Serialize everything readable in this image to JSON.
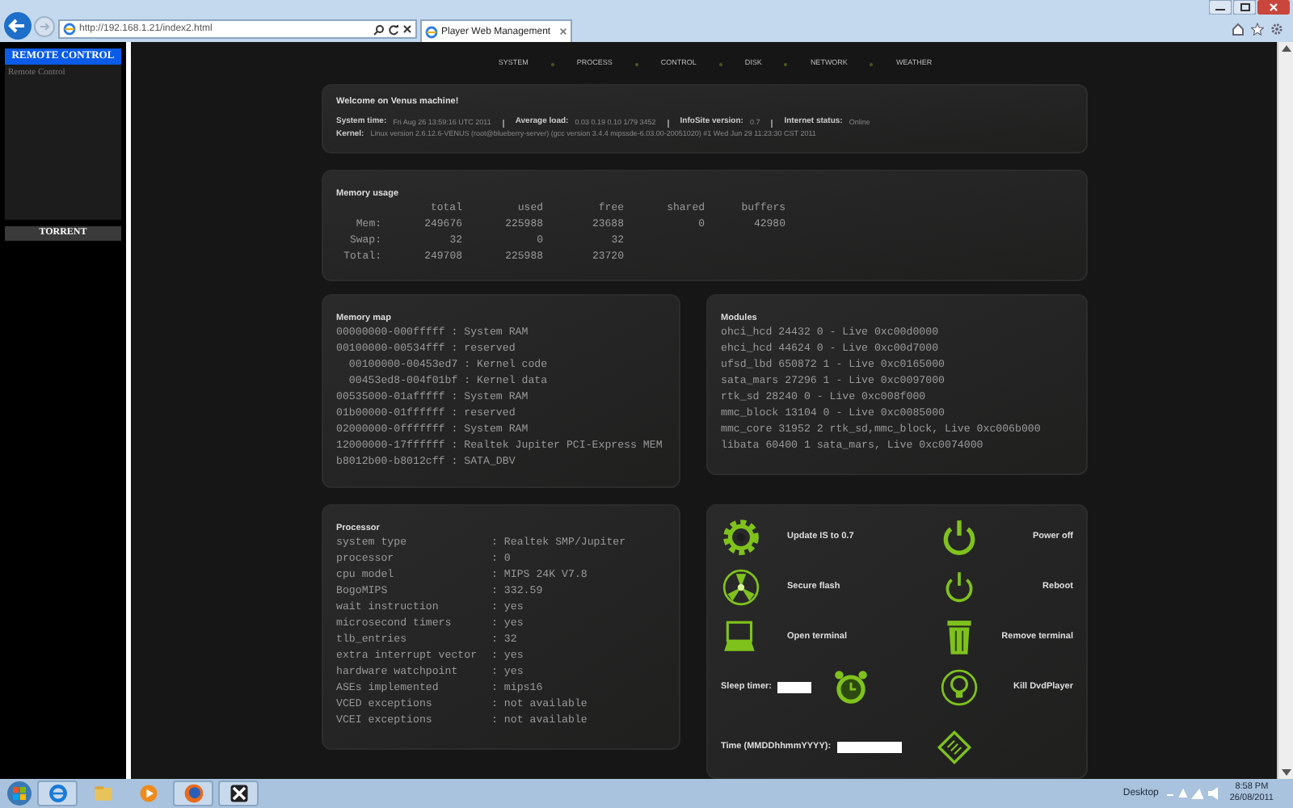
{
  "browser": {
    "url": "http://192.168.1.21/index2.html",
    "tab_title": "Player Web Management"
  },
  "sidebar": {
    "header": "REMOTE CONTROL",
    "link": "Remote Control",
    "torrent": "TORRENT"
  },
  "nav": [
    {
      "label": "SYSTEM"
    },
    {
      "label": "PROCESS"
    },
    {
      "label": "CONTROL"
    },
    {
      "label": "DISK"
    },
    {
      "label": "NETWORK"
    },
    {
      "label": "WEATHER"
    }
  ],
  "welcome": {
    "title": "Welcome on Venus machine!",
    "fields": [
      {
        "label": "System time:",
        "value": "Fri Aug 26 13:59:16 UTC 2011"
      },
      {
        "label": "Average load:",
        "value": "0.03 0.19 0.10 1/79 3452"
      },
      {
        "label": "InfoSite version:",
        "value": "0.7"
      },
      {
        "label": "Internet status:",
        "value": "Online"
      }
    ],
    "kernel": {
      "label": "Kernel:",
      "value": "Linux version 2.6.12.6-VENUS (root@blueberry-server) (gcc version 3.4.4 mipssde-6.03.00-20051020) #1 Wed Jun 29 11:23:30 CST 2011"
    }
  },
  "memory_usage": {
    "title": "Memory usage",
    "columns": [
      "total",
      "used",
      "free",
      "shared",
      "buffers"
    ],
    "rows": [
      {
        "label": "Mem:",
        "values": [
          "249676",
          "225988",
          "23688",
          "0",
          "42980"
        ]
      },
      {
        "label": "Swap:",
        "values": [
          "32",
          "0",
          "32"
        ]
      },
      {
        "label": "Total:",
        "values": [
          "249708",
          "225988",
          "23720"
        ]
      }
    ]
  },
  "memory_map": {
    "title": "Memory map",
    "lines": [
      "00000000-000fffff : System RAM",
      "00100000-00534fff : reserved",
      "  00100000-00453ed7 : Kernel code",
      "  00453ed8-004f01bf : Kernel data",
      "00535000-01afffff : System RAM",
      "01b00000-01ffffff : reserved",
      "02000000-0fffffff : System RAM",
      "12000000-17ffffff : Realtek Jupiter PCI-Express MEM",
      "b8012b00-b8012cff : SATA_DBV"
    ]
  },
  "modules": {
    "title": "Modules",
    "lines": [
      "ohci_hcd 24432 0 - Live 0xc00d0000",
      "ehci_hcd 44624 0 - Live 0xc00d7000",
      "ufsd_lbd 650872 1 - Live 0xc0165000",
      "sata_mars 27296 1 - Live 0xc0097000",
      "rtk_sd 28240 0 - Live 0xc008f000",
      "mmc_block 13104 0 - Live 0xc0085000",
      "mmc_core 31952 2 rtk_sd,mmc_block, Live 0xc006b000",
      "libata 60400 1 sata_mars, Live 0xc0074000"
    ]
  },
  "processor": {
    "title": "Processor",
    "rows": [
      {
        "key": "system type",
        "value": ": Realtek SMP/Jupiter"
      },
      {
        "key": "processor",
        "value": ": 0"
      },
      {
        "key": "cpu model",
        "value": ": MIPS 24K V7.8"
      },
      {
        "key": "BogoMIPS",
        "value": ": 332.59"
      },
      {
        "key": "wait instruction",
        "value": ": yes"
      },
      {
        "key": "microsecond timers",
        "value": ": yes"
      },
      {
        "key": "tlb_entries",
        "value": ": 32"
      },
      {
        "key": "extra interrupt vector",
        "value": ": yes"
      },
      {
        "key": "hardware watchpoint",
        "value": ": yes"
      },
      {
        "key": "ASEs implemented",
        "value": ": mips16"
      },
      {
        "key": "VCED exceptions",
        "value": ": not available"
      },
      {
        "key": "VCEI exceptions",
        "value": ": not available"
      }
    ]
  },
  "controls": [
    {
      "kind": "action",
      "label": "Update IS to 0.7"
    },
    {
      "kind": "action",
      "label": "Power off"
    },
    {
      "kind": "action",
      "label": "Secure flash"
    },
    {
      "kind": "action",
      "label": "Reboot"
    },
    {
      "kind": "action",
      "label": "Open terminal"
    },
    {
      "kind": "action",
      "label": "Remove terminal"
    },
    {
      "kind": "field",
      "label": "Sleep timer:"
    },
    {
      "kind": "action",
      "label": "Kill DvdPlayer"
    },
    {
      "kind": "field",
      "label": "Time (MMDDhhmmYYYY):"
    }
  ],
  "taskbar": {
    "desktop": "Desktop",
    "time": "8:58 PM",
    "date": "26/08/2011"
  }
}
